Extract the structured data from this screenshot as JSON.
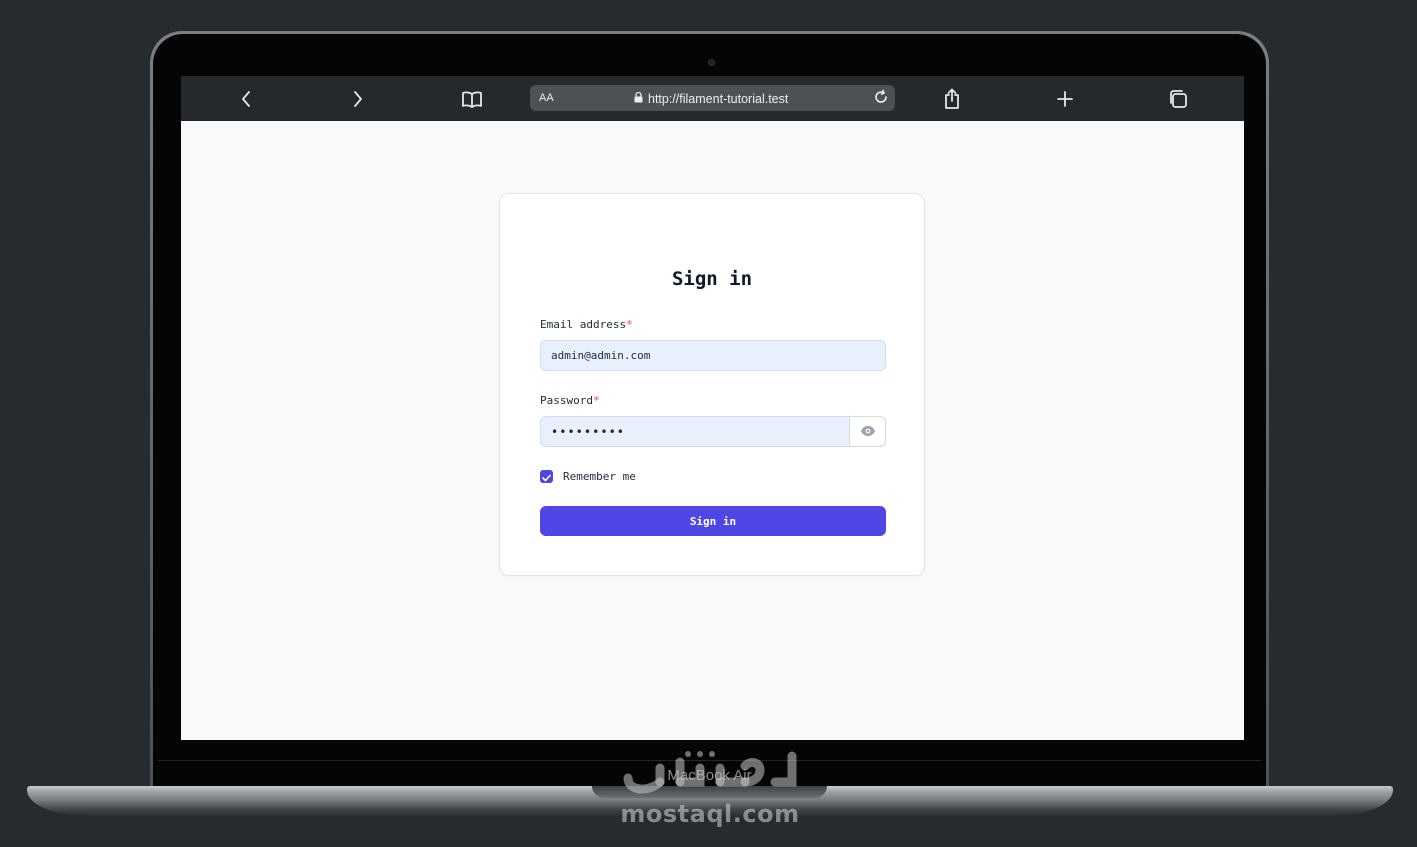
{
  "device": {
    "model_label": "MacBook Air"
  },
  "browser": {
    "text_size_label": "AA",
    "url": "http://filament-tutorial.test",
    "icons": [
      "chevron-left-icon",
      "chevron-right-icon",
      "book-icon",
      "lock-icon",
      "reload-icon",
      "share-icon",
      "plus-icon",
      "tabs-icon"
    ]
  },
  "login": {
    "title": "Sign in",
    "email": {
      "label": "Email address",
      "required_marker": "*",
      "value": "admin@admin.com"
    },
    "password": {
      "label": "Password",
      "required_marker": "*",
      "value": "•••••••••"
    },
    "remember": {
      "label": "Remember me",
      "checked": true
    },
    "submit_label": "Sign in"
  },
  "watermark": {
    "text": "mostaql.com"
  },
  "colors": {
    "accent": "#4f46e5",
    "input_bg": "#e8f0fe",
    "page_bg": "#f8f9fb",
    "required": "#e05252",
    "browser_bar": "#25292e"
  }
}
